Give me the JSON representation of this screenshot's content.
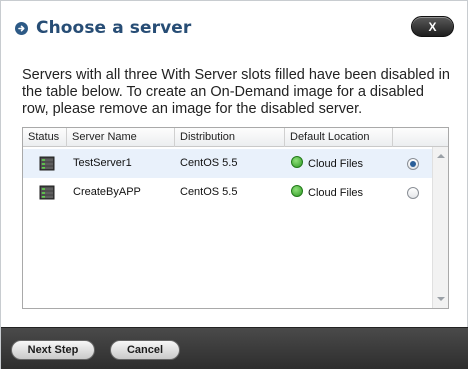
{
  "dialog": {
    "title": "Choose a server",
    "close_label": "X",
    "description": "Servers with all three With Server slots filled have been disabled in the table below. To create an On-Demand image for a disabled row, please remove an image for the disabled server."
  },
  "table": {
    "columns": [
      "Status",
      "Server Name",
      "Distribution",
      "Default Location"
    ],
    "rows": [
      {
        "server_name": "TestServer1",
        "distribution": "CentOS 5.5",
        "location": "Cloud Files",
        "selected": true
      },
      {
        "server_name": "CreateByAPP",
        "distribution": "CentOS 5.5",
        "location": "Cloud Files",
        "selected": false
      }
    ]
  },
  "footer": {
    "next_label": "Next Step",
    "cancel_label": "Cancel"
  },
  "colors": {
    "title": "#274d75",
    "footer_bg": "#2d2d2d",
    "selected_row": "#e9f1fb",
    "status_icon": "green-server"
  }
}
